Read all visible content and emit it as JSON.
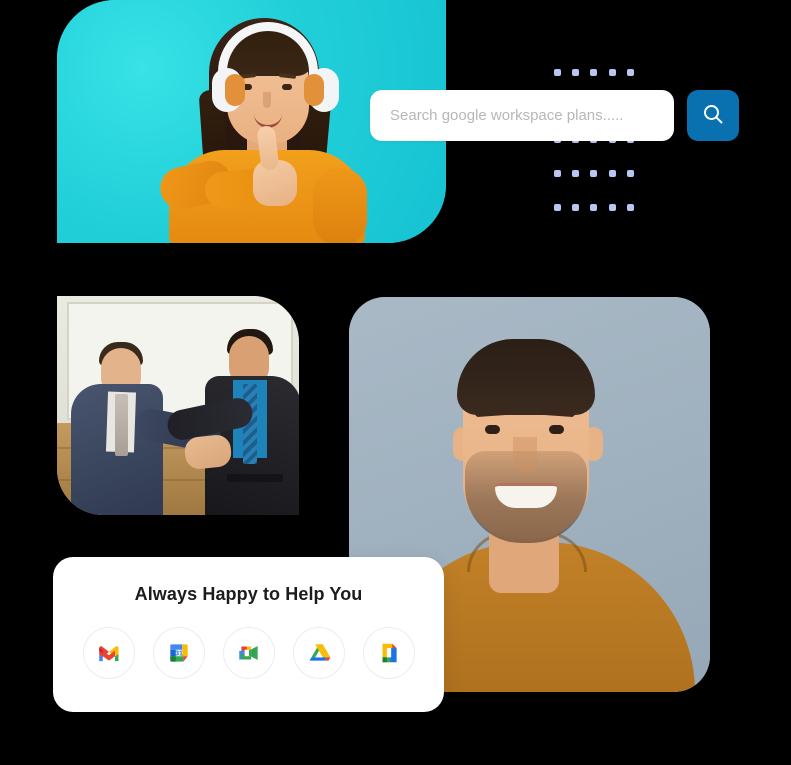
{
  "page": {
    "background_color": "#000000",
    "title": "Google Workspace plans promo panel"
  },
  "search": {
    "placeholder": "Search google workspace plans.....",
    "value": "",
    "button_icon": "search-icon",
    "button_color": "#0a71b0",
    "button_label": "Search"
  },
  "decor": {
    "dot_grid": {
      "rows": 5,
      "columns": 5,
      "color": "#b9c6f2",
      "count": 25
    }
  },
  "media": {
    "hero": {
      "alt": "Woman with white headphones giving a thumbs up",
      "background_color": "#22d3dd"
    },
    "handshake": {
      "alt": "Two businessmen in suits shaking hands in a meeting room"
    },
    "portrait": {
      "alt": "Smiling bearded man in an ochre t-shirt",
      "background_color": "#9fb0bd"
    }
  },
  "help_card": {
    "title": "Always Happy to Help You",
    "apps": [
      {
        "name": "Gmail",
        "icon": "gmail-icon"
      },
      {
        "name": "Google Calendar",
        "icon": "google-calendar-icon",
        "badge": "31"
      },
      {
        "name": "Google Meet",
        "icon": "google-meet-icon"
      },
      {
        "name": "Google Drive",
        "icon": "google-drive-icon"
      },
      {
        "name": "Google Docs",
        "icon": "google-docs-icon"
      }
    ]
  },
  "brand_colors": {
    "google_blue": "#1a73e8",
    "google_red": "#ea4335",
    "google_yellow": "#fbbc04",
    "google_green": "#34a853",
    "accent_blue": "#0a71b0",
    "cyan": "#22d3dd"
  }
}
